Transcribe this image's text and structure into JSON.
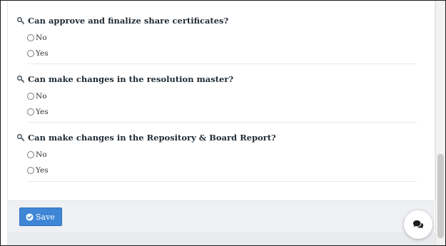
{
  "questions": [
    {
      "label": "Can approve and finalize share certificates?",
      "options": [
        "No",
        "Yes"
      ]
    },
    {
      "label": "Can make changes in the resolution master?",
      "options": [
        "No",
        "Yes"
      ]
    },
    {
      "label": "Can make changes in the Repository & Board Report?",
      "options": [
        "No",
        "Yes"
      ]
    }
  ],
  "footer": {
    "save_label": "Save"
  },
  "icons": {
    "question": "search-key-icon",
    "save": "check-circle-icon",
    "chat": "chat-bubbles-icon"
  },
  "colors": {
    "save_button": "#3f86d6",
    "footer_background": "#eef0f3"
  }
}
